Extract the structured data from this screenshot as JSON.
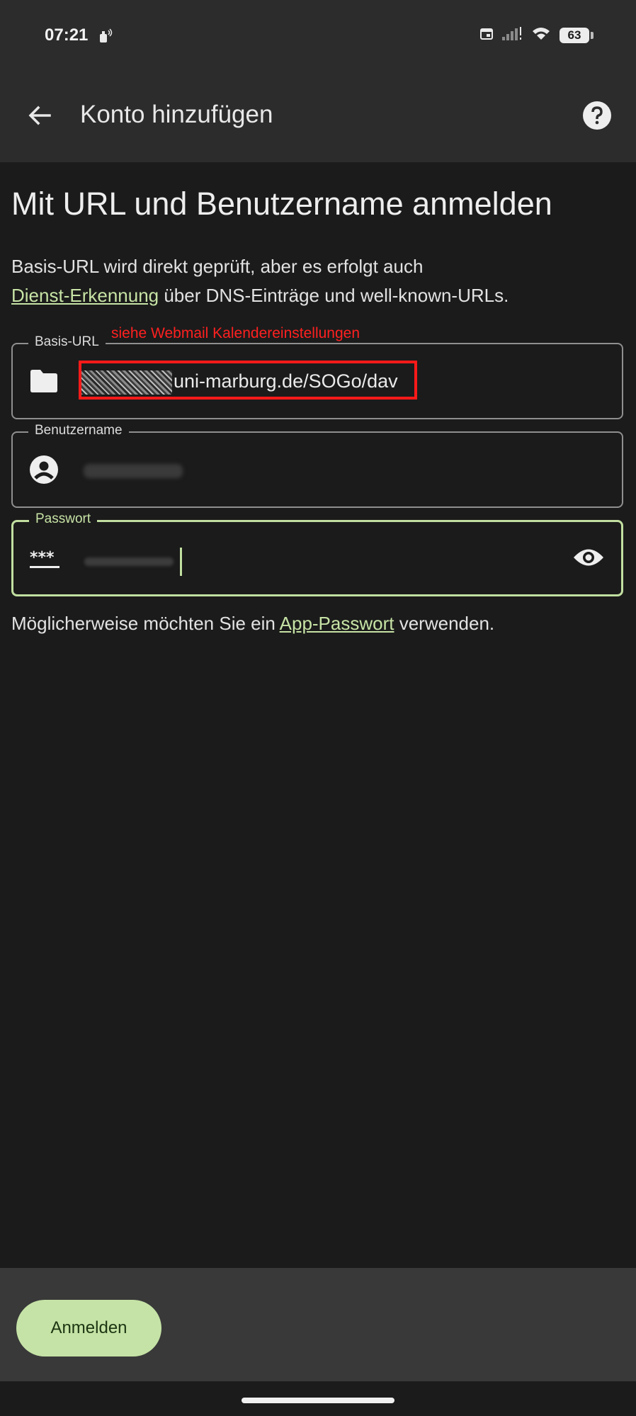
{
  "status_bar": {
    "time": "07:21",
    "battery_level": "63",
    "icons": [
      "calendar-icon",
      "signal-icon",
      "wifi-icon",
      "battery-icon"
    ]
  },
  "app_bar": {
    "title": "Konto hinzufügen",
    "back_icon": "arrow-back-icon",
    "help_icon": "help-icon"
  },
  "content": {
    "heading": "Mit URL und Benutzername anmelden",
    "intro_text_1": "Basis-URL wird direkt geprüft, aber es erfolgt auch",
    "intro_link": "Dienst-Erkennung",
    "intro_text_2": " über DNS-Einträge und well-known-URLs.",
    "annotation": "siehe Webmail Kalendereinstellungen"
  },
  "fields": {
    "base_url": {
      "label": "Basis-URL",
      "value": "uni-marburg.de/SOGo/dav",
      "icon": "folder-icon"
    },
    "username": {
      "label": "Benutzername",
      "value": "",
      "icon": "account-circle-icon"
    },
    "password": {
      "label": "Passwort",
      "value": "",
      "icon": "password-icon",
      "toggle_icon": "eye-icon"
    }
  },
  "hint": {
    "text_1": "Möglicherweise möchten Sie ein ",
    "link": "App-Passwort",
    "text_2": " verwenden."
  },
  "actions": {
    "login_label": "Anmelden"
  },
  "colors": {
    "background": "#1b1b1b",
    "app_bar": "#2c2c2c",
    "accent": "#c5e3a6",
    "annotation": "#ff2020"
  }
}
